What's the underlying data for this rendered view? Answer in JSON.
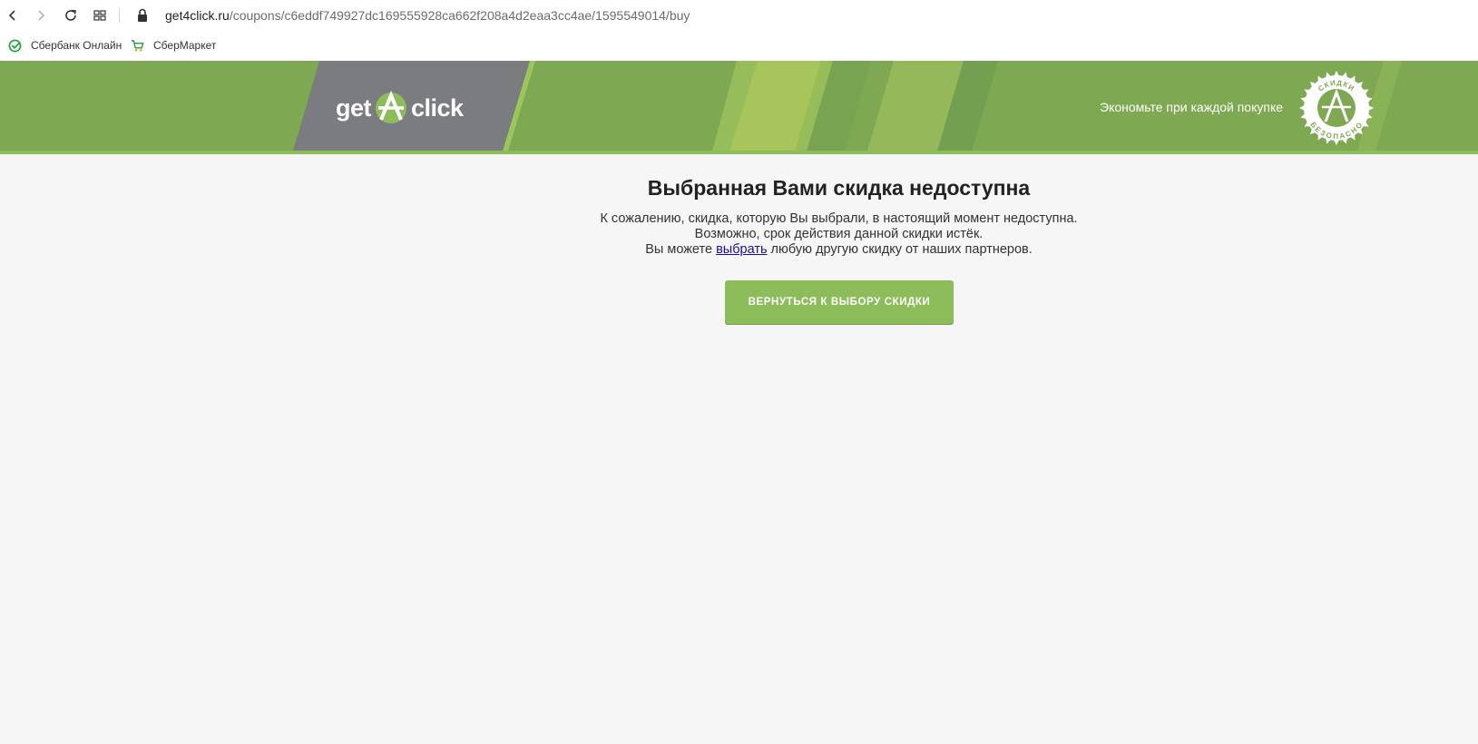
{
  "browser": {
    "url_host": "get4click.ru",
    "url_path": "/coupons/c6eddf749927dc169555928ca662f208a4d2eaa3cc4ae/1595549014/buy",
    "icons": [
      "back-icon",
      "forward-icon",
      "reload-icon",
      "tabs-grid-icon",
      "lock-icon"
    ],
    "bookmarks": [
      {
        "label": "Сбербанк Онлайн",
        "icon": "sberbank-icon"
      },
      {
        "label": "СберМаркет",
        "icon": "cart-icon"
      }
    ]
  },
  "header": {
    "logo_left": "get",
    "logo_right": "click",
    "slogan": "Экономьте при каждой покупке",
    "badge_top": "СКИДКИ",
    "badge_bottom": "БЕЗОПАСНО",
    "colors": {
      "green": "#7ea852",
      "light_green": "#8cbd5a",
      "gray": "#7b7c80"
    }
  },
  "content": {
    "title": "Выбранная Вами скидка недоступна",
    "line1": "К сожалению, скидка, которую Вы выбрали, в настоящий момент недоступна.",
    "line2": "Возможно, срок действия данной скидки истёк.",
    "line3_before": "Вы можете ",
    "line3_link": "выбрать",
    "line3_after": " любую другую скидку от наших партнеров.",
    "button_label": "ВЕРНУТЬСЯ К ВЫБОРУ СКИДКИ"
  }
}
